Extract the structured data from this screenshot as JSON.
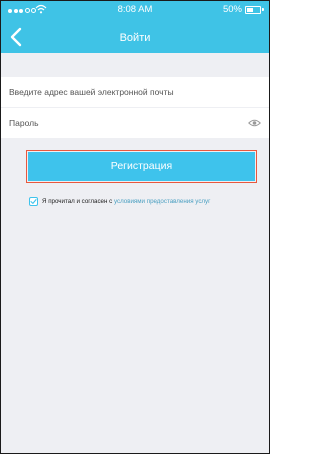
{
  "status_bar": {
    "time": "8:08 AM",
    "battery": "50%",
    "battery_level": 0.5
  },
  "header": {
    "title": "Войти",
    "back_icon": "chevron-left-icon"
  },
  "form": {
    "email_placeholder": "Введите адрес вашей электронной почты",
    "password_placeholder": "Пароль",
    "eye_icon": "eye-icon"
  },
  "register_button": {
    "label": "Регистрация"
  },
  "agreement": {
    "checked": true,
    "text": "Я прочитал и согласен с",
    "link": "условиями предоставления услуг"
  },
  "colors": {
    "accent": "#3fc3e6",
    "button": "#3ec3ec",
    "highlight_border": "#e8583e",
    "background": "#eeeff3"
  }
}
